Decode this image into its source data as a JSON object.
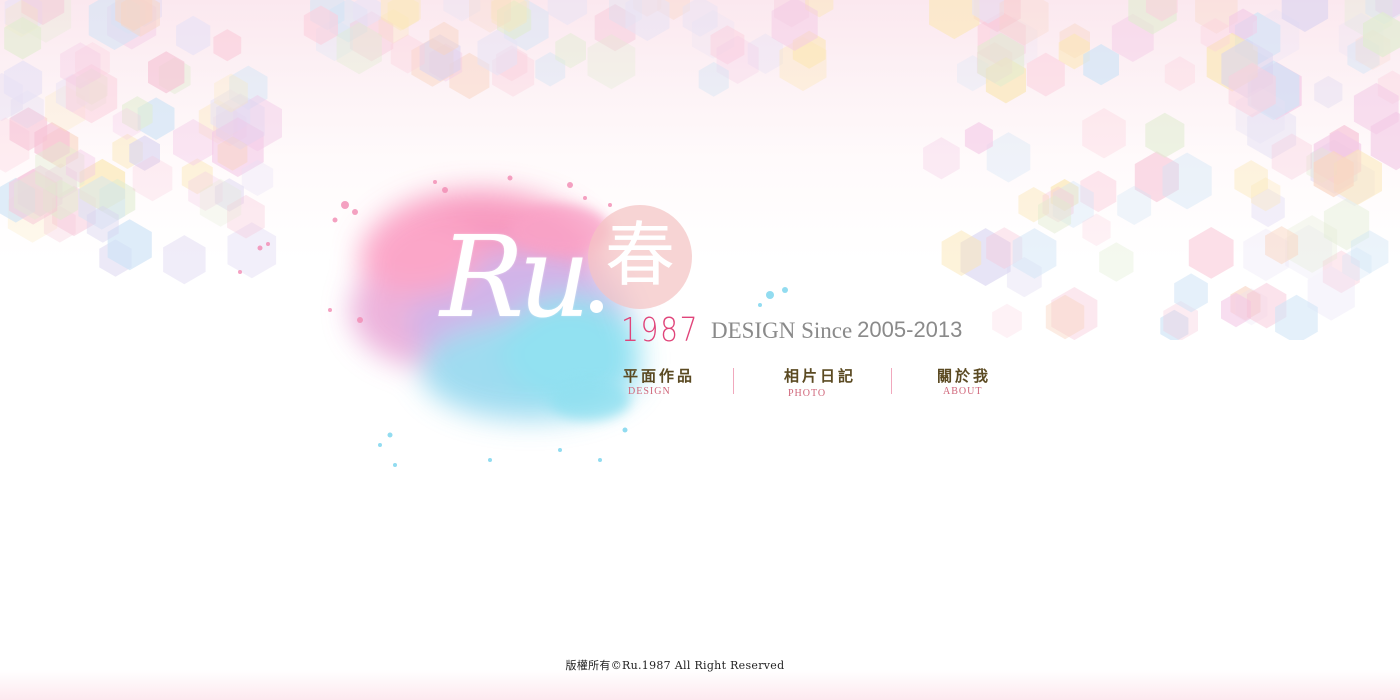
{
  "brand": {
    "logo_text": "Ru",
    "seal_char": "春",
    "year": "1987",
    "design_label": "DESIGN Since",
    "years_range": "2005-2013"
  },
  "nav": [
    {
      "label_zh": "平面作品",
      "label_en": "DESIGN"
    },
    {
      "label_zh": "相片日記",
      "label_en": "PHOTO"
    },
    {
      "label_zh": "關於我",
      "label_en": "ABOUT"
    }
  ],
  "footer": {
    "copyright": "版權所有©Ru.1987 All Right Reserved"
  },
  "colors": {
    "accent": "#e0447a",
    "nav_text": "#5b4a22",
    "nav_sub": "#d0667a",
    "tagline_gray": "#8a8a8a",
    "seal": "#f4c4c4"
  },
  "decor": {
    "background_pattern": "pastel-hexagon-pattern",
    "splash": "watercolor-splash-icon"
  }
}
